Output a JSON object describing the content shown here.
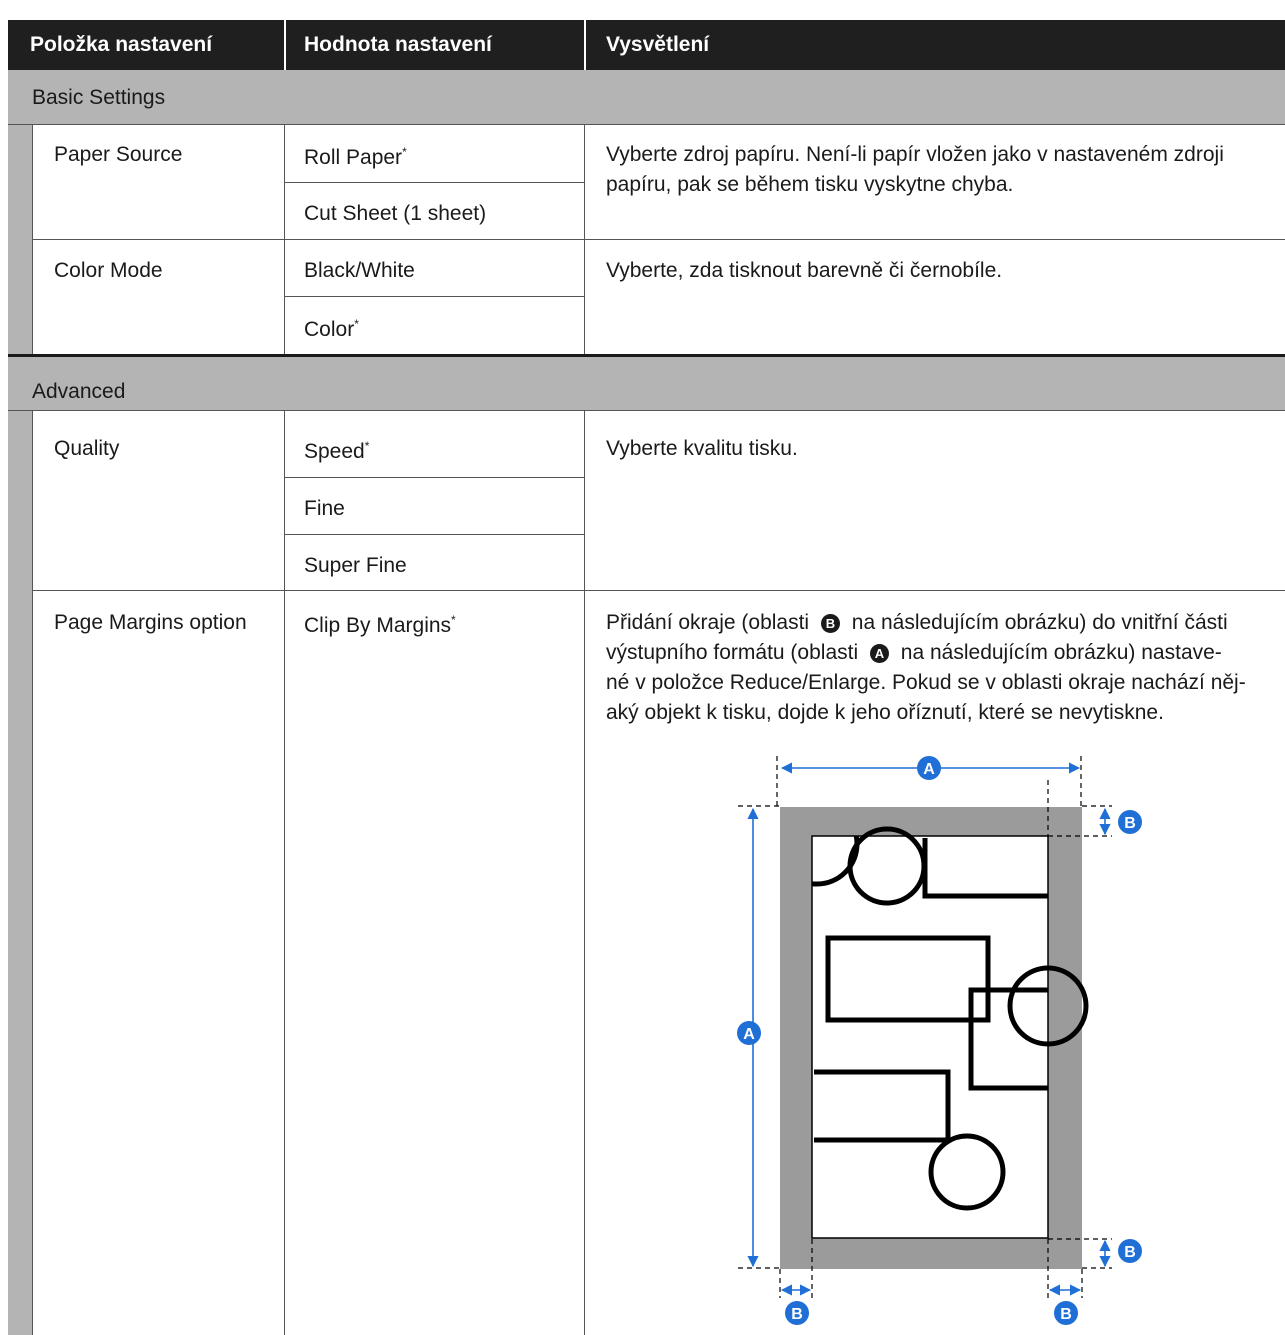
{
  "header": {
    "col1": "Položka nastavení",
    "col2": "Hodnota nastavení",
    "col3": "Vysvětlení"
  },
  "sections": [
    {
      "title": "Basic Settings",
      "rows": [
        {
          "item": "Paper Source",
          "values": [
            {
              "label": "Roll Paper",
              "default": true
            },
            {
              "label": "Cut Sheet (1 sheet)",
              "default": false
            }
          ],
          "description": "Vyberte zdroj papíru. Není-li papír vložen jako v nastaveném zdroji papíru, pak se během tisku vyskytne chyba."
        },
        {
          "item": "Color Mode",
          "values": [
            {
              "label": "Black/White",
              "default": false
            },
            {
              "label": "Color",
              "default": true
            }
          ],
          "description": "Vyberte, zda tisknout barevně či černobíle."
        }
      ]
    },
    {
      "title": "Advanced",
      "rows": [
        {
          "item": "Quality",
          "values": [
            {
              "label": "Speed",
              "default": true
            },
            {
              "label": "Fine",
              "default": false
            },
            {
              "label": "Super Fine",
              "default": false
            }
          ],
          "description": "Vyberte kvalitu tisku."
        },
        {
          "item": "Page Margins option",
          "values": [
            {
              "label": "Clip By Margins",
              "default": true
            }
          ],
          "description_lines": [
            [
              "Přidání okraje (oblasti ",
              "B",
              " na následujícím obrázku) do vnitřní části"
            ],
            [
              "výstupního formátu (oblasti ",
              "A",
              " na následujícím obrázku) nastave-"
            ],
            [
              "né v položce Reduce/Enlarge. Pokud se v oblasti okraje nachází něj-"
            ],
            [
              "aký objekt k tisku, dojde k jeho oříznutí, které se nevytiskne."
            ]
          ]
        }
      ]
    }
  ],
  "default_marker": "*",
  "figure": {
    "label_output_size": "A",
    "label_margin": "B",
    "accent_color": "#1f6fd6",
    "margin_color": "#9b9b9b"
  }
}
